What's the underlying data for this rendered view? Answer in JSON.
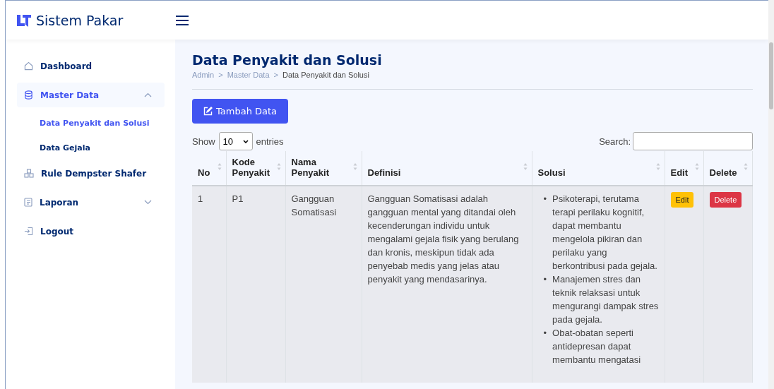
{
  "brand": {
    "title": "Sistem Pakar"
  },
  "sidebar": {
    "items": [
      {
        "label": "Dashboard",
        "selected": false
      },
      {
        "label": "Master Data",
        "selected": true,
        "expanded": true,
        "children": [
          {
            "label": "Data Penyakit dan Solusi",
            "selected": true
          },
          {
            "label": "Data Gejala",
            "selected": false
          }
        ]
      },
      {
        "label": "Rule Dempster Shafer",
        "selected": false
      },
      {
        "label": "Laporan",
        "selected": false,
        "expanded": false
      },
      {
        "label": "Logout",
        "selected": false
      }
    ]
  },
  "page": {
    "title": "Data Penyakit dan Solusi",
    "breadcrumb": [
      "Admin",
      ">",
      "Master Data",
      ">",
      "Data Penyakit dan Solusi"
    ]
  },
  "add_button": "Tambah Data",
  "length": {
    "before": "Show",
    "value": "10",
    "after": "entries"
  },
  "search": {
    "label": "Search:"
  },
  "table": {
    "columns": [
      "No",
      "Kode Penyakit",
      "Nama Penyakit",
      "Definisi",
      "Solusi",
      "Edit",
      "Delete"
    ],
    "rows": [
      {
        "no": "1",
        "code": "P1",
        "name": "Gangguan Somatisasi",
        "definition": "Gangguan Somatisasi adalah gangguan mental yang ditandai oleh kecenderungan individu untuk mengalami gejala fisik yang berulang dan kronis, meskipun tidak ada penyebab medis yang jelas atau penyakit yang mendasarinya.",
        "solutions": [
          {
            "marker": "•",
            "text": "Psikoterapi, terutama terapi perilaku kognitif, dapat membantu mengelola pikiran dan perilaku yang berkontribusi pada gejala."
          },
          {
            "marker": "•",
            "text": "Manajemen stres dan teknik relaksasi untuk mengurangi dampak stres pada gejala."
          },
          {
            "marker": "•",
            "text": "Obat-obatan seperti antidepresan dapat membantu mengatasi"
          }
        ],
        "edit": "Edit",
        "delete": "Delete"
      }
    ]
  }
}
